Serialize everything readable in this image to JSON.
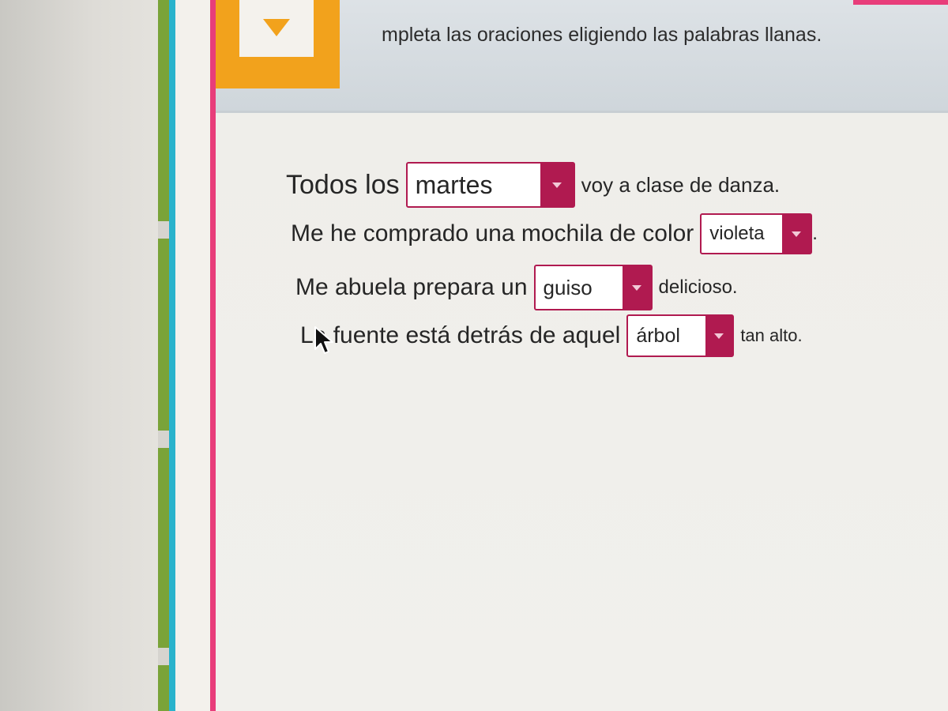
{
  "header": {
    "instruction": "mpleta las oraciones eligiendo las palabras llanas."
  },
  "sentences": [
    {
      "before": "Todos los",
      "selected": "martes",
      "after": "voy a clase de danza."
    },
    {
      "before": "Me he comprado una mochila de color",
      "selected": "violeta",
      "after": "."
    },
    {
      "before": "Me abuela prepara un",
      "selected": "guiso",
      "after": "delicioso."
    },
    {
      "before": "La fuente está detrás de aquel",
      "selected": "árbol",
      "after": "tan alto."
    }
  ],
  "colors": {
    "accent_pink": "#e83d7a",
    "dropdown_crimson": "#b01a50",
    "icon_orange": "#f2a21c",
    "edge_green": "#7aa339",
    "edge_teal": "#29b3cc"
  },
  "icons": {
    "dropdown": "chevron-down-icon",
    "header": "triangle-down-icon",
    "pointer": "mouse-cursor-icon"
  }
}
